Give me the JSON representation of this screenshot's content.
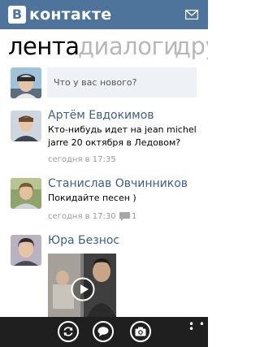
{
  "header": {
    "logo_letter": "В",
    "logo_text": "контакте",
    "mail_icon": "mail-icon"
  },
  "tabs": [
    {
      "label": "лента",
      "active": true
    },
    {
      "label": "диалоги",
      "active": false
    },
    {
      "label": "дру",
      "active": false
    }
  ],
  "composer": {
    "placeholder": "Что у вас нового?"
  },
  "posts": [
    {
      "author": "Артём Евдокимов",
      "text": "Кто-нибудь идет на jean michel jarre 20 октября в Ледовом?",
      "time": "сегодня в 17:35"
    },
    {
      "author": "Станислав Овчинников",
      "text": "Покидайте песен )",
      "time": "сегодня в 17:30",
      "comments": "1"
    },
    {
      "author": "Юра Безнос",
      "attachment": "video"
    }
  ],
  "appbar": {
    "buttons": [
      "refresh-icon",
      "chat-icon",
      "camera-icon"
    ],
    "more": "• • •"
  },
  "colors": {
    "header_bg": "#4f749b",
    "author": "#3d5f85",
    "appbar_bg": "#1f1f1f"
  }
}
